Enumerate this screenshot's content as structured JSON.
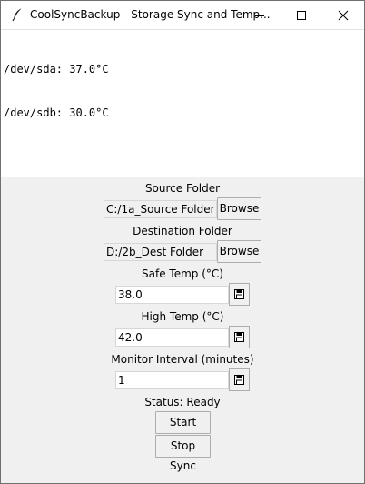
{
  "window": {
    "title": "CoolSyncBackup - Storage Sync and Temp...",
    "icon": "feather-icon"
  },
  "log": {
    "lines": [
      "/dev/sda: 37.0°C",
      "/dev/sdb: 30.0°C"
    ]
  },
  "source": {
    "label": "Source Folder",
    "value": "C:/1a_Source Folder",
    "browse_label": "Browse"
  },
  "destination": {
    "label": "Destination Folder",
    "value": "D:/2b_Dest Folder",
    "browse_label": "Browse"
  },
  "safe_temp": {
    "label": "Safe Temp (°C)",
    "value": "38.0",
    "save_icon": "floppy-disk-icon"
  },
  "high_temp": {
    "label": "High Temp (°C)",
    "value": "42.0",
    "save_icon": "floppy-disk-icon"
  },
  "interval": {
    "label": "Monitor Interval (minutes)",
    "value": "1",
    "save_icon": "floppy-disk-icon"
  },
  "status": {
    "text": "Status: Ready"
  },
  "buttons": {
    "start_label": "Start Sync",
    "stop_label": "Stop Sync"
  }
}
